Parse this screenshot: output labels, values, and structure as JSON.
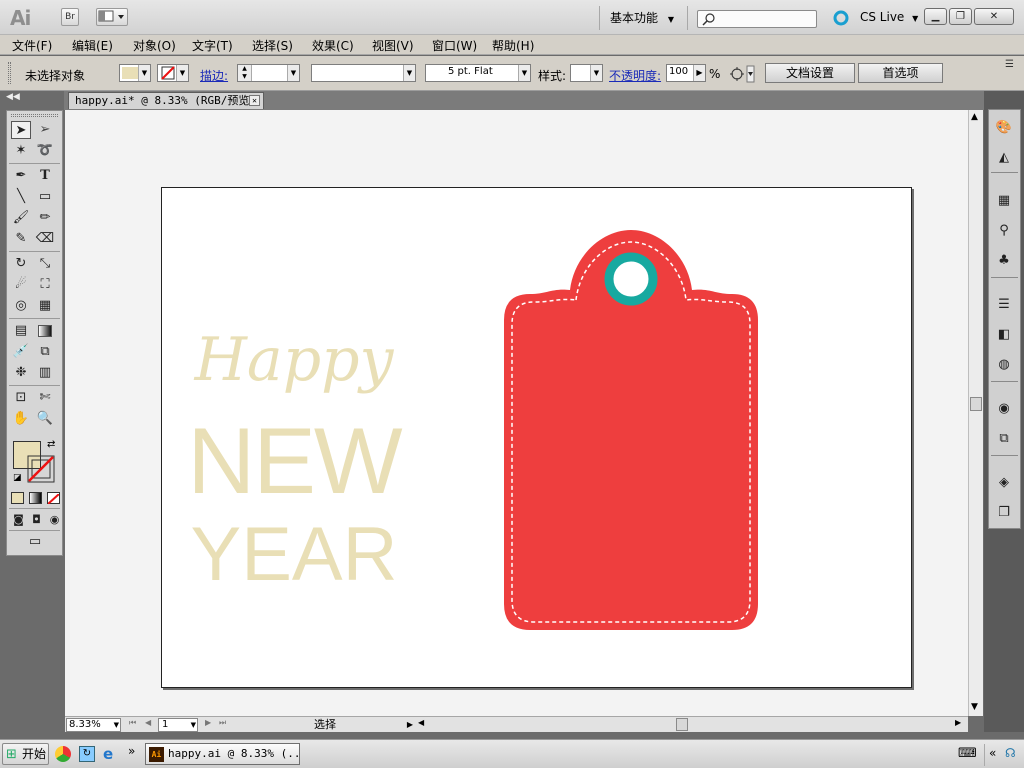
{
  "app": {
    "logo": "Ai",
    "bridge_label": "Br",
    "workspace_label": "基本功能",
    "cslive_label": "CS Live"
  },
  "menu": [
    "文件(F)",
    "编辑(E)",
    "对象(O)",
    "文字(T)",
    "选择(S)",
    "效果(C)",
    "视图(V)",
    "窗口(W)",
    "帮助(H)"
  ],
  "control": {
    "selection_status": "未选择对象",
    "stroke_label": "描边:",
    "brush_value": "5 pt. Flat",
    "style_label": "样式:",
    "opacity_label": "不透明度:",
    "opacity_value": "100",
    "opacity_unit": "%",
    "doc_setup_button": "文档设置",
    "preferences_button": "首选项"
  },
  "document_tab": {
    "title": "happy.ai* @ 8.33% (RGB/预览)"
  },
  "artwork": {
    "line1": "Happy",
    "line2": "NEW",
    "line3": "YEAR",
    "text_color": "#e9dfb6",
    "tag_color": "#ee3e3e",
    "ring_color": "#17a9a0"
  },
  "status": {
    "zoom": "8.33%",
    "artboard_number": "1",
    "tool_status": "选择"
  },
  "taskbar": {
    "start_label": "开始",
    "task_title": "happy.ai @ 8.33% (..."
  },
  "colors": {
    "fill_swatch": "#e9dfb6"
  }
}
